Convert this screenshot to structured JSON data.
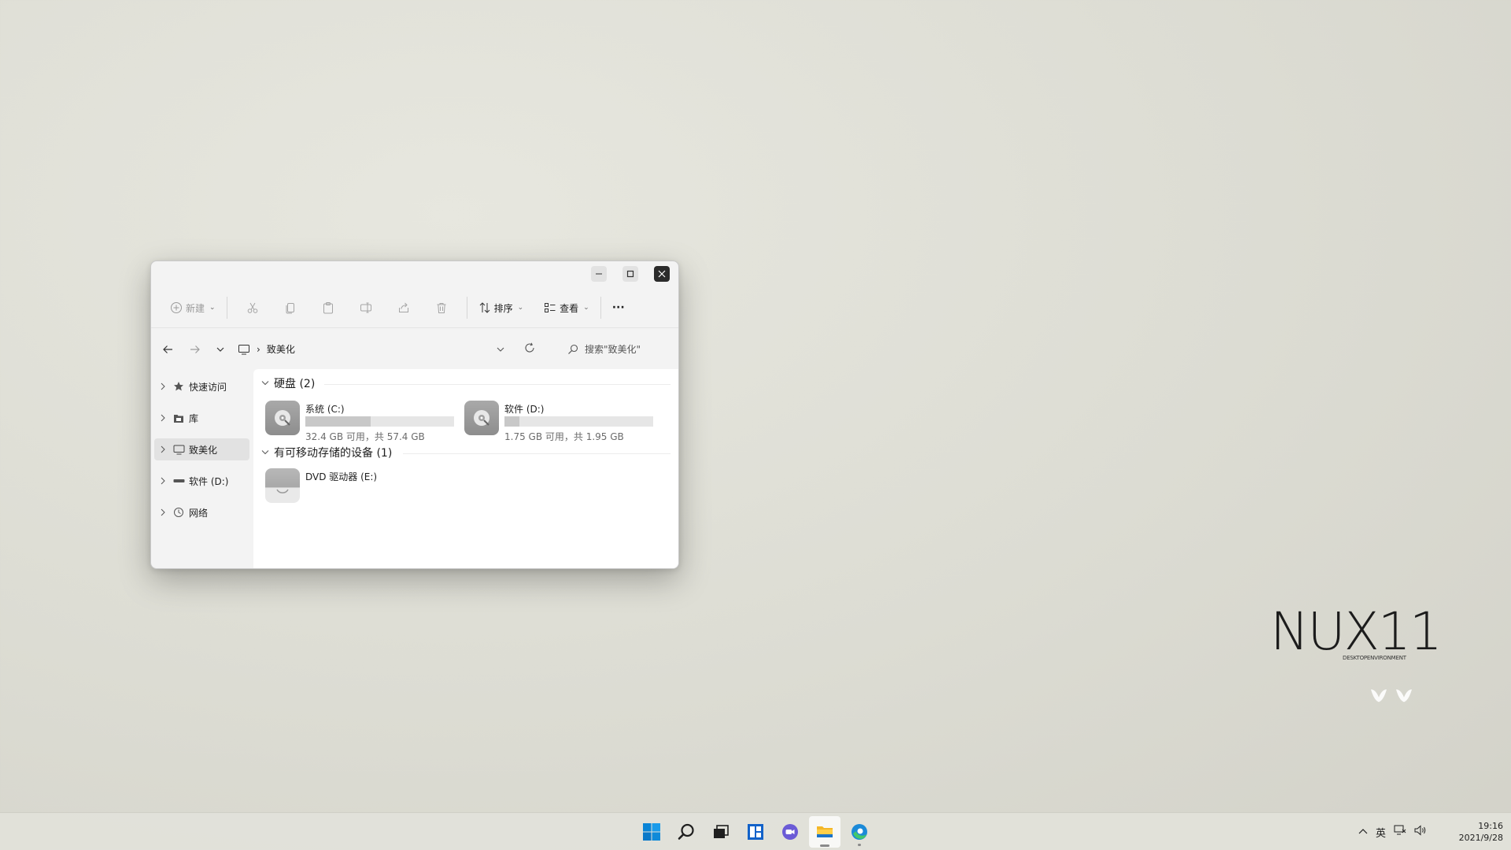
{
  "window": {
    "toolbar": {
      "new_label": "新建",
      "sort_label": "排序",
      "view_label": "查看",
      "more_label": "···"
    },
    "address": {
      "location": "致美化",
      "search_placeholder": "搜索\"致美化\""
    },
    "sidebar": {
      "items": [
        {
          "label": "快速访问",
          "icon": "star-icon"
        },
        {
          "label": "库",
          "icon": "library-icon"
        },
        {
          "label": "致美化",
          "icon": "computer-icon",
          "selected": true
        },
        {
          "label": "软件 (D:)",
          "icon": "drive-icon"
        },
        {
          "label": "网络",
          "icon": "network-icon"
        }
      ]
    },
    "content": {
      "hard_disks_header": "硬盘 (2)",
      "drives": [
        {
          "name": "系统 (C:)",
          "size": "32.4 GB 可用，共 57.4 GB",
          "used_fraction": 0.44
        },
        {
          "name": "软件 (D:)",
          "size": "1.75 GB 可用，共 1.95 GB",
          "used_fraction": 0.1
        }
      ],
      "removable_header": "有可移动存储的设备 (1)",
      "removable": [
        {
          "name": "DVD 驱动器 (E:)"
        }
      ]
    }
  },
  "desktop": {
    "brand_title": "NUX11",
    "brand_subtitle": "DESKTOPENVIRONMENT"
  },
  "taskbar": {
    "apps": [
      "windows-start-icon",
      "search-icon",
      "task-view-icon",
      "widgets-icon",
      "chat-icon",
      "file-explorer-icon",
      "edge-icon"
    ],
    "tray": {
      "ime": "英"
    },
    "clock": {
      "time": "19:16",
      "date": "2021/9/28"
    }
  },
  "colors": {
    "accent": "#0078d4",
    "close_button": "#2b2b2b",
    "selected_nav": "#e2e2e2"
  }
}
